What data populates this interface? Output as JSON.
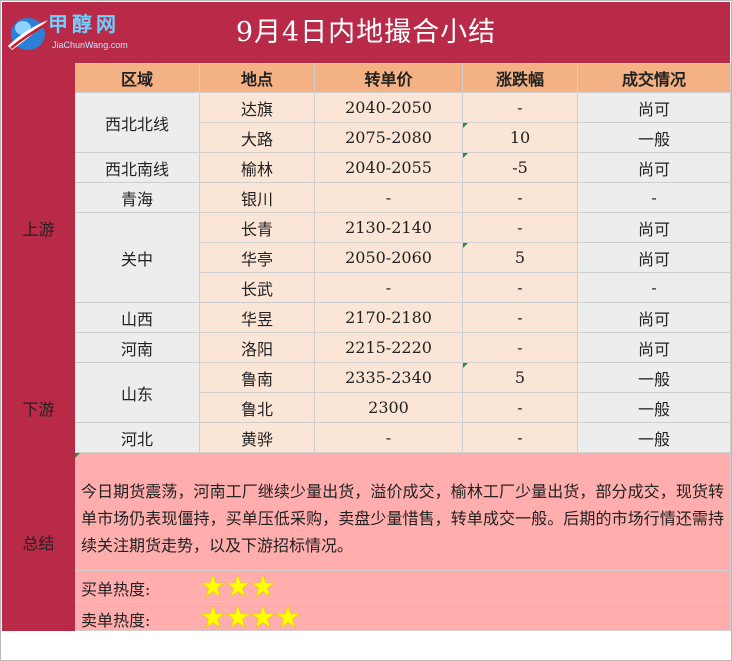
{
  "header": {
    "logo_text": "甲醇网",
    "logo_url": "JiaChunWang.com",
    "title": "9月4日内地撮合小结"
  },
  "columns": [
    "区域",
    "地点",
    "转单价",
    "涨跌幅",
    "成交情况"
  ],
  "groups": [
    {
      "label": "上游"
    },
    {
      "label": "下游"
    }
  ],
  "rows": [
    {
      "region": "西北北线",
      "location": "达旗",
      "price": "2040-2050",
      "change": "-",
      "deal": "尚可"
    },
    {
      "location": "大路",
      "price": "2075-2080",
      "change": "10",
      "deal": "一般"
    },
    {
      "region": "西北南线",
      "location": "榆林",
      "price": "2040-2055",
      "change": "-5",
      "deal": "尚可"
    },
    {
      "region": "青海",
      "location": "银川",
      "price": "-",
      "change": "-",
      "deal": "-"
    },
    {
      "region": "关中",
      "location": "长青",
      "price": "2130-2140",
      "change": "-",
      "deal": "尚可"
    },
    {
      "location": "华亭",
      "price": "2050-2060",
      "change": "5",
      "deal": "尚可"
    },
    {
      "location": "长武",
      "price": "-",
      "change": "-",
      "deal": "-"
    },
    {
      "region": "山西",
      "location": "华昱",
      "price": "2170-2180",
      "change": "-",
      "deal": "尚可"
    },
    {
      "region": "河南",
      "location": "洛阳",
      "price": "2215-2220",
      "change": "-",
      "deal": "尚可"
    },
    {
      "region": "山东",
      "location": "鲁南",
      "price": "2335-2340",
      "change": "5",
      "deal": "一般"
    },
    {
      "location": "鲁北",
      "price": "2300",
      "change": "-",
      "deal": "一般"
    },
    {
      "region": "河北",
      "location": "黄骅",
      "price": "-",
      "change": "-",
      "deal": "一般"
    }
  ],
  "summary": {
    "label": "总结",
    "text": "今日期货震荡，河南工厂继续少量出货，溢价成交，榆林工厂少量出货，部分成交，现货转单市场仍表现僵持，买单压低采购，卖盘少量惜售，转单成交一般。后期的市场行情还需持续关注期货走势，以及下游招标情况。",
    "buy_heat_label": "买单热度:",
    "buy_heat_stars": 3,
    "sell_heat_label": "卖单热度:",
    "sell_heat_stars": 4,
    "star_color": "#ffff00"
  }
}
